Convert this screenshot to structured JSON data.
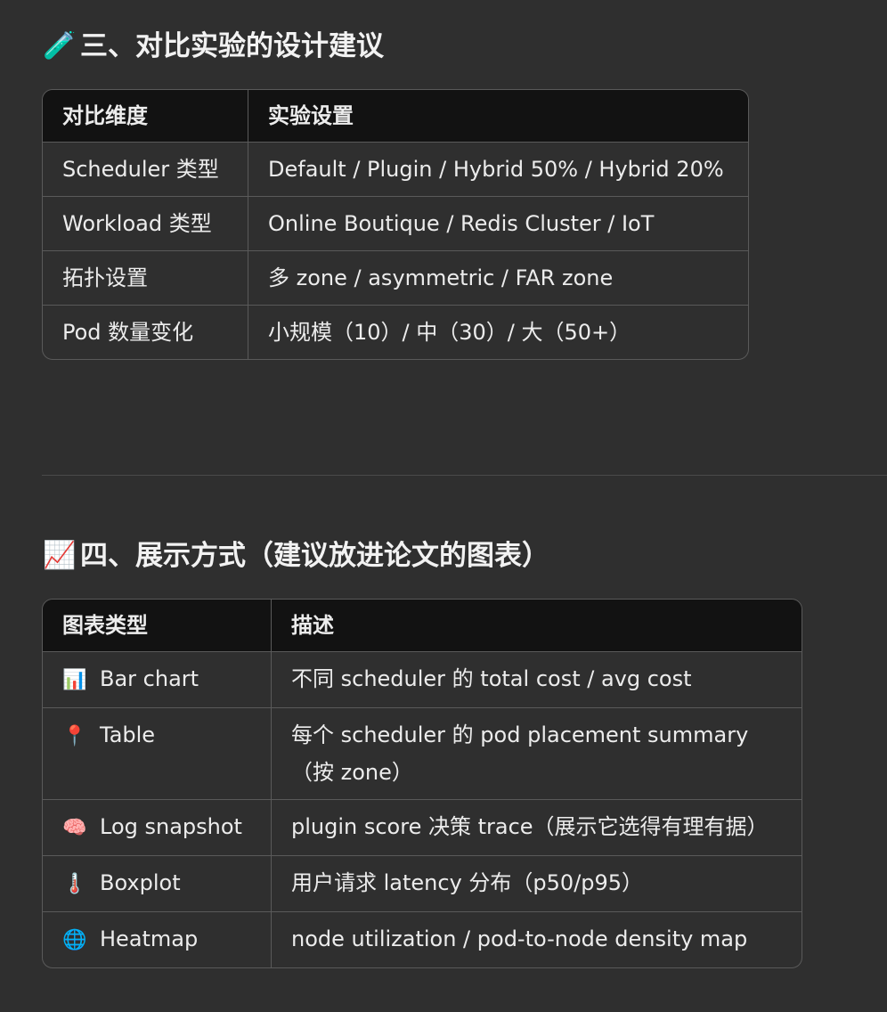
{
  "section3": {
    "emoji": "🧪",
    "title": "三、对比实验的设计建议",
    "headers": [
      "对比维度",
      "实验设置"
    ],
    "rows": [
      [
        "Scheduler 类型",
        "Default / Plugin / Hybrid 50% / Hybrid 20%"
      ],
      [
        "Workload 类型",
        "Online Boutique / Redis Cluster / IoT"
      ],
      [
        "拓扑设置",
        "多 zone / asymmetric / FAR zone"
      ],
      [
        "Pod 数量变化",
        "小规模（10）/ 中（30）/ 大（50+）"
      ]
    ]
  },
  "section4": {
    "emoji": "📈",
    "title": "四、展示方式（建议放进论文的图表）",
    "headers": [
      "图表类型",
      "描述"
    ],
    "rows": [
      {
        "icon": "📊",
        "icon_name": "bar-chart-icon",
        "type": "Bar chart",
        "desc": "不同 scheduler 的 total cost / avg cost"
      },
      {
        "icon": "📍",
        "icon_name": "pin-icon",
        "type": "Table",
        "desc": "每个 scheduler 的 pod placement summary（按 zone）"
      },
      {
        "icon": "🧠",
        "icon_name": "brain-icon",
        "type": "Log snapshot",
        "desc": "plugin score 决策 trace（展示它选得有理有据）"
      },
      {
        "icon": "🌡️",
        "icon_name": "thermometer-icon",
        "type": "Boxplot",
        "desc": "用户请求 latency 分布（p50/p95）"
      },
      {
        "icon": "🌐",
        "icon_name": "globe-icon",
        "type": "Heatmap",
        "desc": "node utilization / pod-to-node density map"
      }
    ]
  }
}
